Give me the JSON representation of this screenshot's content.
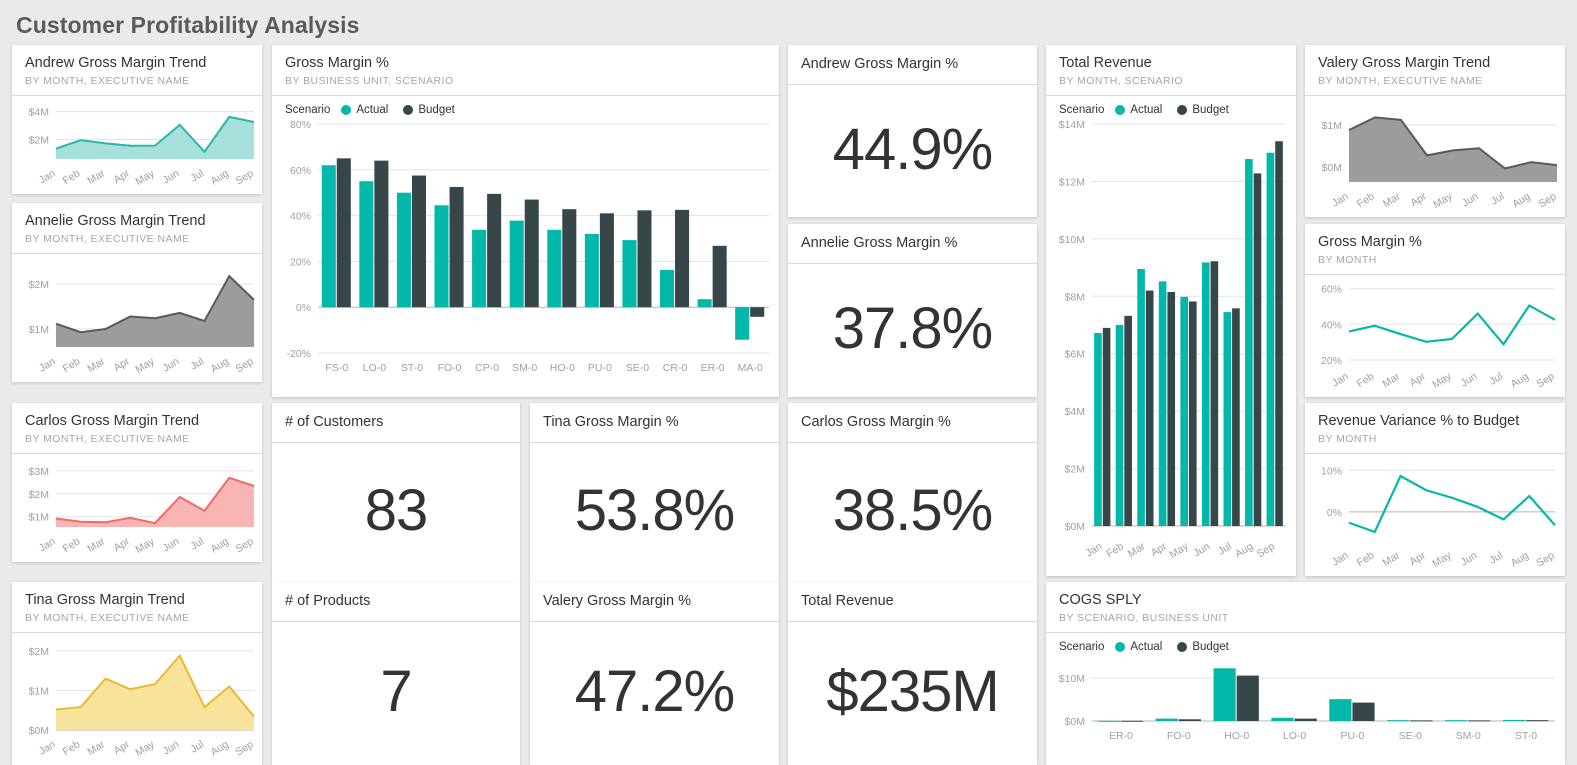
{
  "page": {
    "title": "Customer Profitability Analysis"
  },
  "colors": {
    "actual": "#01b8aa",
    "budget": "#374649",
    "background": "#eaeaea",
    "card": "#ffffff",
    "text": "#333333",
    "subtext": "#a6a6a6"
  },
  "legend": {
    "label": "Scenario",
    "actual": "Actual",
    "budget": "Budget"
  },
  "tiles": {
    "andrew_trend": {
      "title": "Andrew Gross Margin Trend",
      "subtitle": "BY MONTH, EXECUTIVE NAME"
    },
    "annelie_trend": {
      "title": "Annelie Gross Margin Trend",
      "subtitle": "BY MONTH, EXECUTIVE NAME"
    },
    "carlos_trend": {
      "title": "Carlos Gross Margin Trend",
      "subtitle": "BY MONTH, EXECUTIVE NAME"
    },
    "tina_trend": {
      "title": "Tina Gross Margin Trend",
      "subtitle": "BY MONTH, EXECUTIVE NAME"
    },
    "gm_by_bu": {
      "title": "Gross Margin %",
      "subtitle": "BY BUSINESS UNIT, SCENARIO"
    },
    "num_customers": {
      "title": "# of Customers",
      "value": "83"
    },
    "num_products": {
      "title": "# of Products",
      "value": "7"
    },
    "tina_gm": {
      "title": "Tina Gross Margin %",
      "value": "53.8%"
    },
    "valery_gm": {
      "title": "Valery Gross Margin %",
      "value": "47.2%"
    },
    "andrew_gm": {
      "title": "Andrew Gross Margin %",
      "value": "44.9%"
    },
    "annelie_gm": {
      "title": "Annelie Gross Margin %",
      "value": "37.8%"
    },
    "carlos_gm": {
      "title": "Carlos Gross Margin %",
      "value": "38.5%"
    },
    "total_revenue_kpi": {
      "title": "Total Revenue",
      "value": "$235M"
    },
    "total_revenue_chart": {
      "title": "Total Revenue",
      "subtitle": "BY MONTH, SCENARIO"
    },
    "valery_trend": {
      "title": "Valery Gross Margin Trend",
      "subtitle": "BY MONTH, EXECUTIVE NAME"
    },
    "gm_by_month": {
      "title": "Gross Margin %",
      "subtitle": "BY MONTH"
    },
    "rev_variance": {
      "title": "Revenue Variance % to Budget",
      "subtitle": "BY MONTH"
    },
    "cogs_sply": {
      "title": "COGS SPLY",
      "subtitle": "BY SCENARIO, BUSINESS UNIT"
    }
  },
  "chart_data": [
    {
      "id": "andrew_trend",
      "type": "area",
      "title": "Andrew Gross Margin Trend",
      "subtitle": "BY MONTH, EXECUTIVE NAME",
      "xlabel": "",
      "ylabel": "",
      "categories": [
        "Jan",
        "Feb",
        "Mar",
        "Apr",
        "May",
        "Jun",
        "Jul",
        "Aug",
        "Sep"
      ],
      "values": [
        1.35,
        1.95,
        1.72,
        1.55,
        1.56,
        3.05,
        1.12,
        3.62,
        3.25
      ],
      "ylim": [
        0.6,
        4.4
      ],
      "ticks": [
        "$4M",
        "$2M"
      ],
      "tick_values": [
        4,
        2
      ],
      "line_color": "#2cb5a8",
      "fill_color": "#a5e0da",
      "grid": true
    },
    {
      "id": "annelie_trend",
      "type": "area",
      "title": "Annelie Gross Margin Trend",
      "subtitle": "BY MONTH, EXECUTIVE NAME",
      "categories": [
        "Jan",
        "Feb",
        "Mar",
        "Apr",
        "May",
        "Jun",
        "Jul",
        "Aug",
        "Sep"
      ],
      "values": [
        1.12,
        0.93,
        1.0,
        1.28,
        1.24,
        1.36,
        1.18,
        2.18,
        1.65
      ],
      "ylim": [
        0.6,
        2.45
      ],
      "ticks": [
        "$2M",
        "$1M"
      ],
      "tick_values": [
        2,
        1
      ],
      "line_color": "#595959",
      "fill_color": "#9c9c9c",
      "grid": true
    },
    {
      "id": "carlos_trend",
      "type": "area",
      "title": "Carlos Gross Margin Trend",
      "subtitle": "BY MONTH, EXECUTIVE NAME",
      "categories": [
        "Jan",
        "Feb",
        "Mar",
        "Apr",
        "May",
        "Jun",
        "Jul",
        "Aug",
        "Sep"
      ],
      "values": [
        0.92,
        0.78,
        0.76,
        0.95,
        0.72,
        1.86,
        1.26,
        2.7,
        2.34
      ],
      "ylim": [
        0.55,
        3.3
      ],
      "ticks": [
        "$3M",
        "$2M",
        "$1M"
      ],
      "tick_values": [
        3,
        2,
        1
      ],
      "line_color": "#f06a6a",
      "fill_color": "#f9b4b4",
      "grid": true
    },
    {
      "id": "tina_trend",
      "type": "area",
      "title": "Tina Gross Margin Trend",
      "subtitle": "BY MONTH, EXECUTIVE NAME",
      "categories": [
        "Jan",
        "Feb",
        "Mar",
        "Apr",
        "May",
        "Jun",
        "Jul",
        "Aug",
        "Sep"
      ],
      "values": [
        0.52,
        0.58,
        1.3,
        1.03,
        1.16,
        1.88,
        0.58,
        1.1,
        0.34
      ],
      "ylim": [
        0,
        2.2
      ],
      "ticks": [
        "$2M",
        "$1M",
        "$0M"
      ],
      "tick_values": [
        2,
        1,
        0
      ],
      "line_color": "#e8b931",
      "fill_color": "#f7e49a",
      "grid": true
    },
    {
      "id": "gm_by_bu",
      "type": "bar",
      "title": "Gross Margin %",
      "subtitle": "BY BUSINESS UNIT, SCENARIO",
      "legend_label": "Scenario",
      "categories": [
        "FS-0",
        "LO-0",
        "ST-0",
        "FO-0",
        "CP-0",
        "SM-0",
        "HO-0",
        "PU-0",
        "SE-0",
        "CR-0",
        "ER-0",
        "MA-0"
      ],
      "series": [
        {
          "name": "Actual",
          "color": "#01b8aa",
          "values": [
            62.0,
            55.0,
            50.0,
            44.5,
            33.8,
            37.8,
            33.8,
            32.0,
            29.3,
            16.3,
            3.5,
            -14.2
          ]
        },
        {
          "name": "Budget",
          "color": "#374649",
          "values": [
            65.0,
            64.0,
            57.5,
            52.5,
            49.5,
            47.0,
            42.8,
            41.0,
            42.3,
            42.5,
            26.8,
            -4.2
          ]
        }
      ],
      "ylim": [
        -20,
        80
      ],
      "yticks": [
        80,
        60,
        40,
        20,
        0,
        -20
      ],
      "ytick_labels": [
        "80%",
        "60%",
        "40%",
        "20%",
        "0%",
        "-20%"
      ],
      "grid": true,
      "legend_position": "top-left"
    },
    {
      "id": "total_revenue_chart",
      "type": "bar",
      "title": "Total Revenue",
      "subtitle": "BY MONTH, SCENARIO",
      "legend_label": "Scenario",
      "categories": [
        "Jan",
        "Feb",
        "Mar",
        "Apr",
        "May",
        "Jun",
        "Jul",
        "Aug",
        "Sep"
      ],
      "series": [
        {
          "name": "Actual",
          "color": "#01b8aa",
          "values": [
            6.72,
            7.0,
            8.95,
            8.52,
            7.98,
            9.18,
            7.45,
            12.78,
            13.0
          ]
        },
        {
          "name": "Budget",
          "color": "#374649",
          "values": [
            6.9,
            7.32,
            8.2,
            8.15,
            7.82,
            9.22,
            7.58,
            12.28,
            13.4
          ]
        }
      ],
      "ylim": [
        0,
        14
      ],
      "yticks": [
        14,
        12,
        10,
        8,
        6,
        4,
        2,
        0
      ],
      "ytick_labels": [
        "$14M",
        "$12M",
        "$10M",
        "$8M",
        "$6M",
        "$4M",
        "$2M",
        "$0M"
      ],
      "grid": true,
      "legend_position": "top-left"
    },
    {
      "id": "valery_trend",
      "type": "area",
      "title": "Valery Gross Margin Trend",
      "subtitle": "BY MONTH, EXECUTIVE NAME",
      "categories": [
        "Jan",
        "Feb",
        "Mar",
        "Apr",
        "May",
        "Jun",
        "Jul",
        "Aug",
        "Sep"
      ],
      "values": [
        0.88,
        1.18,
        1.12,
        0.28,
        0.4,
        0.45,
        -0.03,
        0.12,
        0.05
      ],
      "ylim": [
        -0.35,
        1.45
      ],
      "ticks": [
        "$1M",
        "$0M"
      ],
      "tick_values": [
        1,
        0
      ],
      "line_color": "#595959",
      "fill_color": "#9c9c9c",
      "grid": true
    },
    {
      "id": "gm_by_month",
      "type": "line",
      "title": "Gross Margin %",
      "subtitle": "BY MONTH",
      "categories": [
        "Jan",
        "Feb",
        "Mar",
        "Apr",
        "May",
        "Jun",
        "Jul",
        "Aug",
        "Sep"
      ],
      "values": [
        36.0,
        39.2,
        34.5,
        30.2,
        31.8,
        46.0,
        28.8,
        50.5,
        42.5
      ],
      "ylim": [
        20,
        62
      ],
      "yticks": [
        60,
        40,
        20
      ],
      "ytick_labels": [
        "60%",
        "40%",
        "20%"
      ],
      "line_color": "#01b8aa",
      "grid": true
    },
    {
      "id": "rev_variance",
      "type": "line",
      "title": "Revenue Variance % to Budget",
      "subtitle": "BY MONTH",
      "categories": [
        "Jan",
        "Feb",
        "Mar",
        "Apr",
        "May",
        "Jun",
        "Jul",
        "Aug",
        "Sep"
      ],
      "values": [
        -2.6,
        -4.8,
        8.6,
        5.2,
        3.4,
        1.2,
        -1.8,
        3.8,
        -3.2
      ],
      "ylim": [
        -6.5,
        11.5
      ],
      "yticks": [
        10,
        0
      ],
      "ytick_labels": [
        "10%",
        "0%"
      ],
      "line_color": "#01b8aa",
      "grid": true
    },
    {
      "id": "cogs_sply",
      "type": "bar",
      "title": "COGS SPLY",
      "subtitle": "BY SCENARIO, BUSINESS UNIT",
      "legend_label": "Scenario",
      "categories": [
        "ER-0",
        "FO-0",
        "HO-0",
        "LO-0",
        "PU-0",
        "SE-0",
        "SM-0",
        "ST-0"
      ],
      "series": [
        {
          "name": "Actual",
          "color": "#01b8aa",
          "values": [
            0.05,
            0.55,
            12.3,
            0.75,
            5.1,
            0.2,
            0.2,
            0.25
          ]
        },
        {
          "name": "Budget",
          "color": "#374649",
          "values": [
            0.05,
            0.4,
            10.6,
            0.55,
            4.3,
            0.15,
            0.15,
            0.2
          ]
        }
      ],
      "ylim": [
        0,
        14
      ],
      "yticks": [
        10,
        0
      ],
      "ytick_labels": [
        "$10M",
        "$0M"
      ],
      "grid": true,
      "legend_position": "top-left"
    }
  ]
}
